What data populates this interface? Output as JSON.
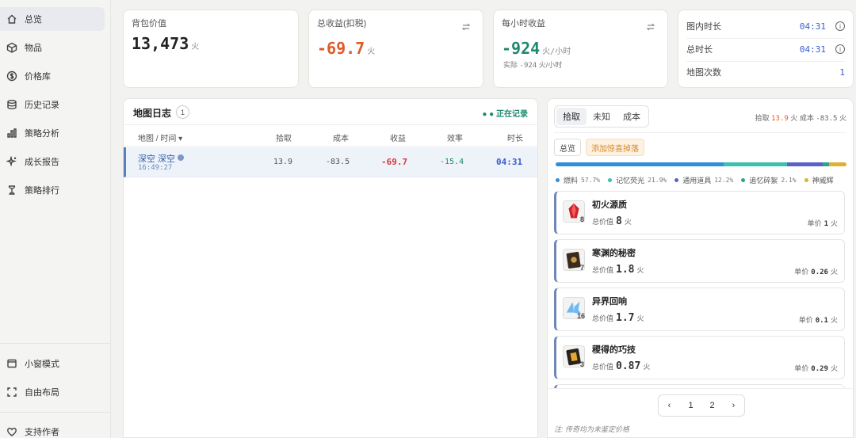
{
  "sidebar": {
    "items": [
      {
        "label": "总览",
        "icon": "home-icon"
      },
      {
        "label": "物品",
        "icon": "box-icon"
      },
      {
        "label": "价格库",
        "icon": "dollar-icon"
      },
      {
        "label": "历史记录",
        "icon": "database-icon"
      },
      {
        "label": "策略分析",
        "icon": "bar-chart-icon"
      },
      {
        "label": "成长报告",
        "icon": "sparkle-icon"
      },
      {
        "label": "策略排行",
        "icon": "trophy-icon"
      }
    ],
    "bottom": [
      {
        "label": "小窗模式",
        "icon": "window-icon"
      },
      {
        "label": "自由布局",
        "icon": "expand-icon"
      },
      {
        "label": "支持作者",
        "icon": "heart-icon"
      }
    ]
  },
  "stats": {
    "bag_value": {
      "label": "背包价值",
      "value": "13,473",
      "unit": "火"
    },
    "total_profit": {
      "label": "总收益(扣税)",
      "value": "-69.7",
      "unit": "火"
    },
    "hourly": {
      "label": "每小时收益",
      "value": "-924",
      "unit": "火/小时",
      "actual_label": "实际",
      "actual_value": "-924",
      "actual_unit": "火/小时"
    },
    "times": [
      {
        "label": "图内时长",
        "value": "04:31"
      },
      {
        "label": "总时长",
        "value": "04:31"
      },
      {
        "label": "地图次数",
        "value": "1"
      }
    ]
  },
  "map_log": {
    "title": "地图日志",
    "count": "1",
    "status": "● 正在记录",
    "columns": [
      "地图 / 时间 ▾",
      "拾取",
      "成本",
      "收益",
      "效率",
      "时长"
    ],
    "rows": [
      {
        "map": "深空 深空",
        "time": "16:49:27",
        "pickup": "13.9",
        "cost": "-83.5",
        "profit": "-69.7",
        "efficiency": "-15.4",
        "duration": "04:31"
      }
    ]
  },
  "drops": {
    "tabs": [
      "拾取",
      "未知",
      "成本"
    ],
    "summary_pickup_label": "拾取",
    "summary_pickup": "13.9",
    "summary_pickup_unit": "火",
    "summary_cost_label": "成本",
    "summary_cost": "-83.5",
    "summary_cost_unit": "火",
    "filters": [
      "总览",
      "添加惊喜掉落"
    ],
    "legend": [
      {
        "name": "燃料",
        "pct": "57.7%",
        "color": "#2f8fd8"
      },
      {
        "name": "记忆荧光",
        "pct": "21.9%",
        "color": "#3cc0b0"
      },
      {
        "name": "通用道具",
        "pct": "12.2%",
        "color": "#5a62c9"
      },
      {
        "name": "追忆碎絮",
        "pct": "2.1%",
        "color": "#2ca58d"
      },
      {
        "name": "神威辉",
        "pct": "",
        "color": "#e0b030"
      }
    ],
    "items": [
      {
        "name": "初火源质",
        "qty": "8",
        "total_label": "总价值",
        "total": "8",
        "unit_label": "单价",
        "unit_price": "1",
        "currency": "火",
        "icon": "red-crystal-icon"
      },
      {
        "name": "寒渊的秘密",
        "qty": "7",
        "total_label": "总价值",
        "total": "1.8",
        "unit_label": "单价",
        "unit_price": "0.26",
        "currency": "火",
        "icon": "dark-card-icon"
      },
      {
        "name": "异界回响",
        "qty": "16",
        "total_label": "总价值",
        "total": "1.7",
        "unit_label": "单价",
        "unit_price": "0.1",
        "currency": "火",
        "icon": "blue-shard-icon"
      },
      {
        "name": "稷得的巧技",
        "qty": "3",
        "total_label": "总价值",
        "total": "0.87",
        "unit_label": "单价",
        "unit_price": "0.29",
        "currency": "火",
        "icon": "gold-card-icon"
      }
    ],
    "pager": [
      "‹",
      "1",
      "2",
      "›"
    ],
    "note": "注: 传奇均为未鉴定价格"
  }
}
